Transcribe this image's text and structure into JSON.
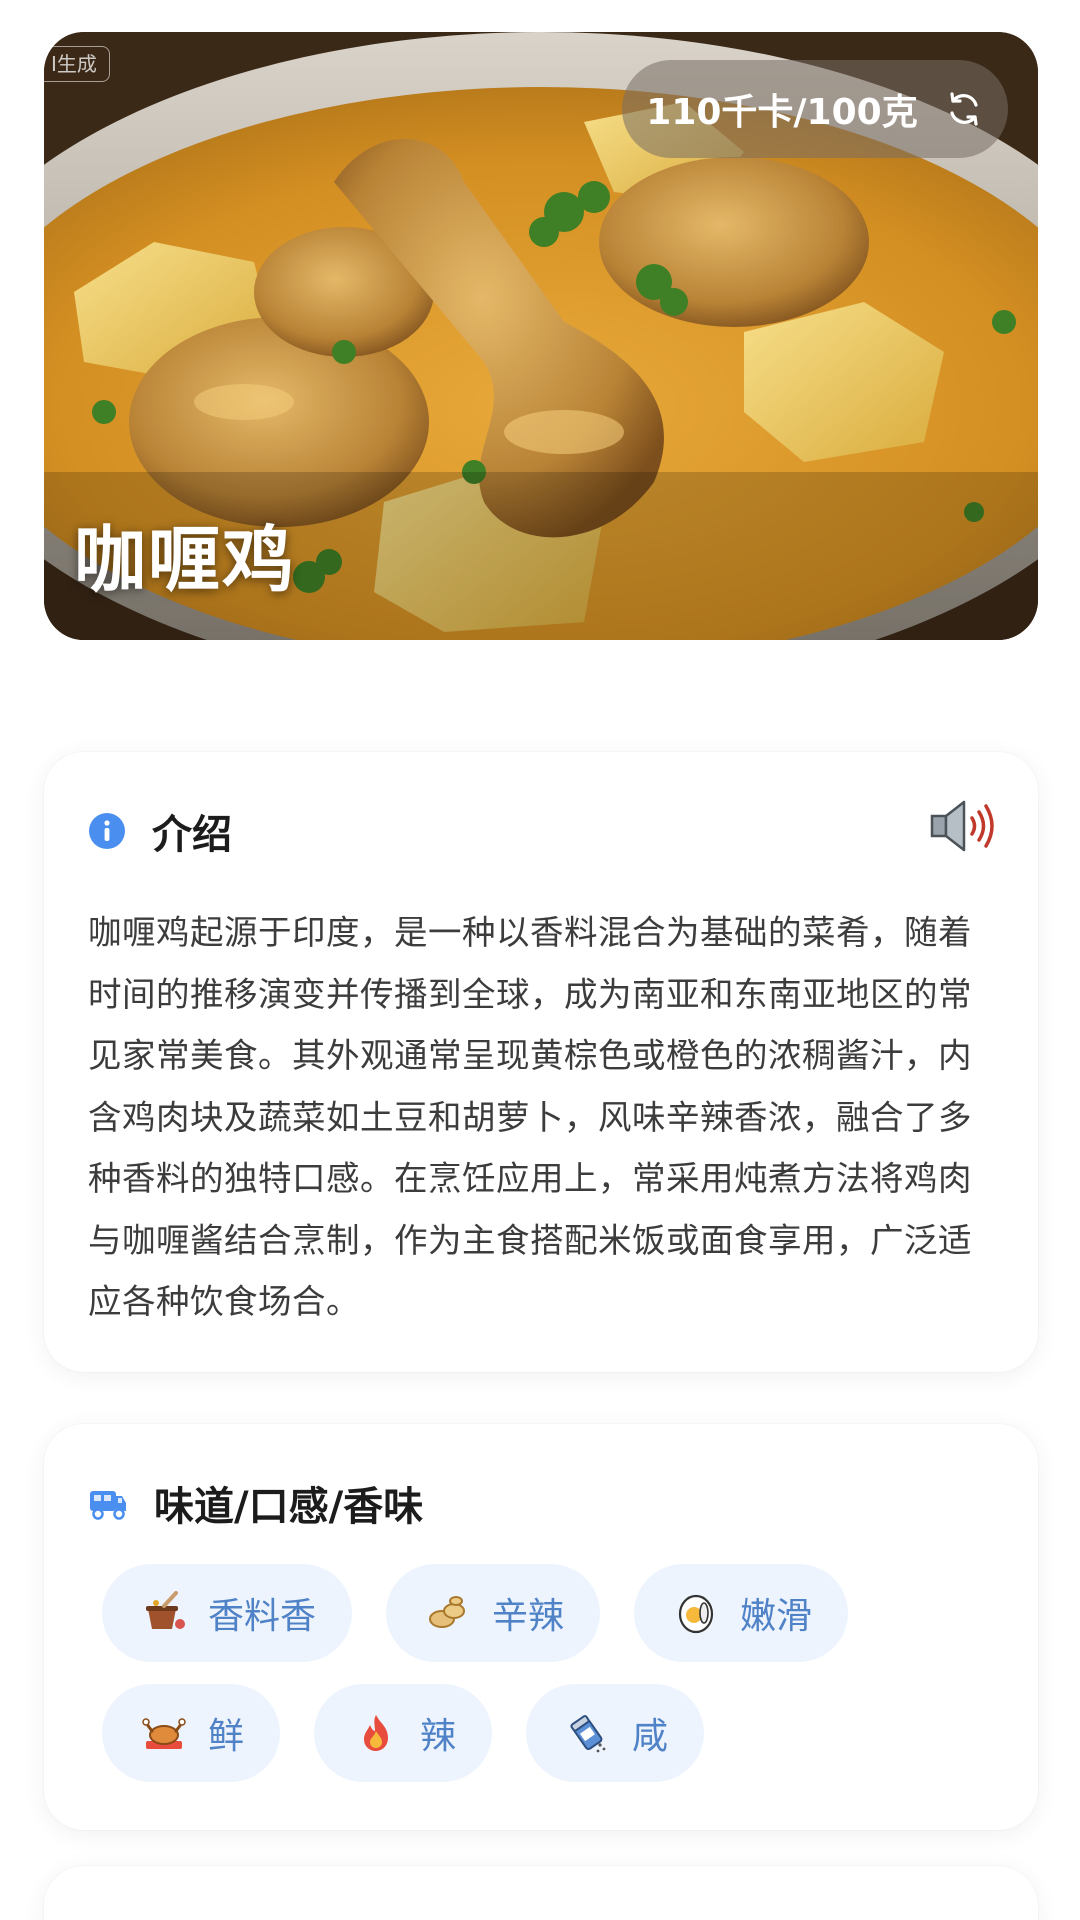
{
  "hero": {
    "ai_tag": "I生成",
    "kcal": "110千卡/100克",
    "title": "咖喱鸡"
  },
  "intro": {
    "title": "介绍",
    "text": "咖喱鸡起源于印度，是一种以香料混合为基础的菜肴，随着时间的推移演变并传播到全球，成为南亚和东南亚地区的常见家常美食。其外观通常呈现黄棕色或橙色的浓稠酱汁，内含鸡肉块及蔬菜如土豆和胡萝卜，风味辛辣香浓，融合了多种香料的独特口感。在烹饪应用上，常采用炖煮方法将鸡肉与咖喱酱结合烹制，作为主食搭配米饭或面食享用，广泛适应各种饮食场合。"
  },
  "taste": {
    "title": "味道/口感/香味",
    "tags": [
      {
        "label": "香料香",
        "icon": "spice-pot-icon"
      },
      {
        "label": "辛辣",
        "icon": "ginger-icon"
      },
      {
        "label": "嫩滑",
        "icon": "egg-icon"
      },
      {
        "label": "鲜",
        "icon": "roast-chicken-icon"
      },
      {
        "label": "辣",
        "icon": "fire-icon"
      },
      {
        "label": "咸",
        "icon": "salt-shaker-icon"
      }
    ]
  },
  "colors": {
    "accent_blue": "#4f82c6",
    "chip_bg": "#eef4fd",
    "info_blue": "#4a8ff0"
  }
}
